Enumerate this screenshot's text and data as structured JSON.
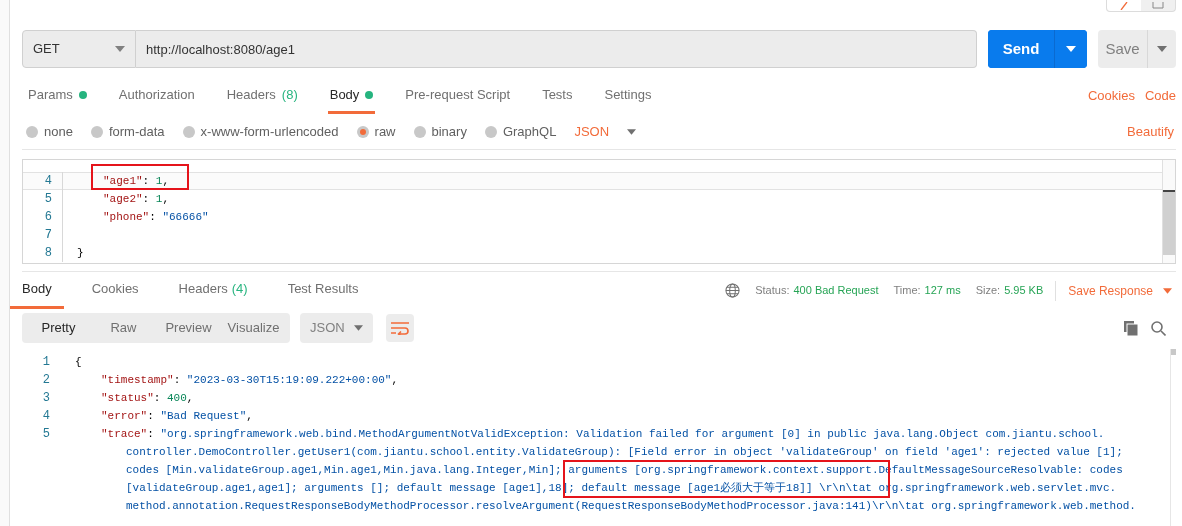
{
  "request": {
    "method": "GET",
    "url": "http://localhost:8080/age1",
    "send": "Send",
    "save": "Save",
    "tabs": [
      {
        "label": "Params",
        "dot": true,
        "selected": false
      },
      {
        "label": "Authorization",
        "dot": false,
        "selected": false
      },
      {
        "label": "Headers",
        "count": "(8)",
        "dot": false,
        "selected": false
      },
      {
        "label": "Body",
        "dot": true,
        "selected": true
      },
      {
        "label": "Pre-request Script",
        "dot": false,
        "selected": false
      },
      {
        "label": "Tests",
        "dot": false,
        "selected": false
      },
      {
        "label": "Settings",
        "dot": false,
        "selected": false
      }
    ],
    "links": [
      "Cookies",
      "Code"
    ],
    "body_types": [
      {
        "label": "none",
        "selected": false
      },
      {
        "label": "form-data",
        "selected": false
      },
      {
        "label": "x-www-form-urlencoded",
        "selected": false
      },
      {
        "label": "raw",
        "selected": true
      },
      {
        "label": "binary",
        "selected": false
      },
      {
        "label": "GraphQL",
        "selected": false
      }
    ],
    "format": "JSON",
    "beautify": "Beautify",
    "editor_lines": [
      {
        "number": "4",
        "kind": "member",
        "highlighted": true,
        "segments": [
          {
            "kind": "key",
            "text": "\"age1\""
          },
          {
            "kind": "punct",
            "text": ": "
          },
          {
            "kind": "number",
            "text": "1"
          },
          {
            "kind": "punct",
            "text": ","
          }
        ]
      },
      {
        "number": "5",
        "kind": "member",
        "highlighted": false,
        "segments": [
          {
            "kind": "key",
            "text": "\"age2\""
          },
          {
            "kind": "punct",
            "text": ": "
          },
          {
            "kind": "number",
            "text": "1"
          },
          {
            "kind": "punct",
            "text": ","
          }
        ]
      },
      {
        "number": "6",
        "kind": "member",
        "highlighted": false,
        "segments": [
          {
            "kind": "key",
            "text": "\"phone\""
          },
          {
            "kind": "punct",
            "text": ": "
          },
          {
            "kind": "string",
            "text": "\"66666\""
          }
        ]
      },
      {
        "number": "7",
        "kind": "member",
        "highlighted": false
      },
      {
        "number": "8",
        "kind": "brace",
        "highlighted": false,
        "segments": [
          {
            "kind": "punct",
            "text": "}"
          }
        ]
      }
    ]
  },
  "response": {
    "tabs": [
      {
        "label": "Body",
        "selected": true
      },
      {
        "label": "Cookies",
        "selected": false
      },
      {
        "label": "Headers",
        "count": "(4)",
        "selected": false
      },
      {
        "label": "Test Results",
        "selected": false
      }
    ],
    "meta": [
      {
        "label": "Status:",
        "value": "400 Bad Request"
      },
      {
        "label": "Time:",
        "value": "127 ms"
      },
      {
        "label": "Size:",
        "value": "5.95 KB"
      }
    ],
    "save_response": "Save Response",
    "views": [
      {
        "label": "Pretty",
        "selected": true
      },
      {
        "label": "Raw",
        "selected": false
      },
      {
        "label": "Preview",
        "selected": false
      },
      {
        "label": "Visualize",
        "selected": false
      }
    ],
    "format": "JSON",
    "wrap_on": true,
    "annotated": true,
    "lines": [
      {
        "number": "1",
        "kind": "brace",
        "segments": [
          {
            "kind": "punct",
            "text": "{"
          }
        ]
      },
      {
        "number": "2",
        "kind": "member",
        "segments": [
          {
            "kind": "key",
            "text": "\"timestamp\""
          },
          {
            "kind": "punct",
            "text": ": "
          },
          {
            "kind": "string",
            "text": "\"2023-03-30T15:19:09.222+00:00\""
          },
          {
            "kind": "punct",
            "text": ","
          }
        ]
      },
      {
        "number": "3",
        "kind": "member",
        "segments": [
          {
            "kind": "key",
            "text": "\"status\""
          },
          {
            "kind": "punct",
            "text": ": "
          },
          {
            "kind": "number",
            "text": "400"
          },
          {
            "kind": "punct",
            "text": ","
          }
        ]
      },
      {
        "number": "4",
        "kind": "member",
        "segments": [
          {
            "kind": "key",
            "text": "\"error\""
          },
          {
            "kind": "punct",
            "text": ": "
          },
          {
            "kind": "string",
            "text": "\"Bad Request\""
          },
          {
            "kind": "punct",
            "text": ","
          }
        ]
      },
      {
        "number": "5",
        "kind": "member",
        "segments": [
          {
            "kind": "key",
            "text": "\"trace\""
          },
          {
            "kind": "punct",
            "text": ": "
          },
          {
            "kind": "string",
            "text": "\"org.springframework.web.bind.MethodArgumentNotValidException: Validation failed for argument [0] in public java.lang.Object com.jiantu.school."
          }
        ]
      },
      {
        "kind": "continuation",
        "segments": [
          {
            "kind": "string",
            "text": "controller.DemoController.getUser1(com.jiantu.school.entity.ValidateGroup): [Field error in object 'validateGroup' on field 'age1': rejected value [1];"
          }
        ]
      },
      {
        "kind": "continuation",
        "segments": [
          {
            "kind": "string",
            "text": "codes [Min.validateGroup.age1,Min.age1,Min.java.lang.Integer,Min]; arguments [org.springframework.context.support.DefaultMessageSourceResolvable: codes"
          }
        ]
      },
      {
        "kind": "continuation",
        "segments": [
          {
            "kind": "string",
            "text": "[validateGroup.age1,age1]; arguments []; default message [age1],18]; default message [age1必须大于等于18]] \\r\\n\\tat org.springframework.web.servlet.mvc."
          }
        ]
      },
      {
        "kind": "continuation",
        "segments": [
          {
            "kind": "string",
            "text": "method.annotation.RequestResponseBodyMethodProcessor.resolveArgument(RequestResponseBodyMethodProcessor.java:141)\\r\\n\\tat org.springframework.web.method."
          }
        ]
      }
    ]
  }
}
